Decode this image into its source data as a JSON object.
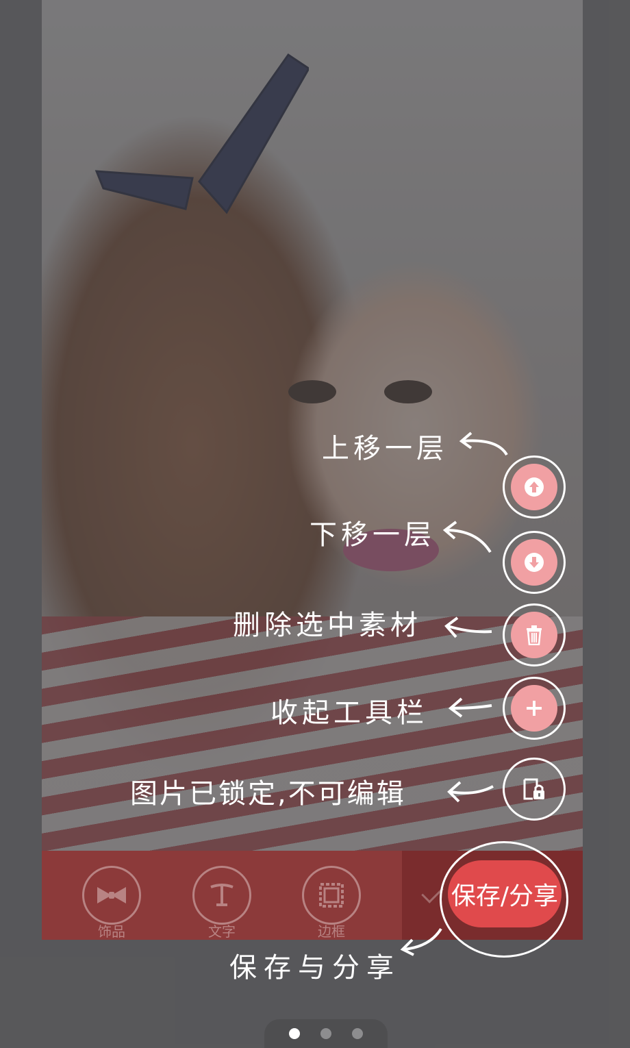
{
  "toolbar": {
    "tools": [
      {
        "label": "饰品",
        "icon": "bow-icon"
      },
      {
        "label": "文字",
        "icon": "text-icon"
      },
      {
        "label": "边框",
        "icon": "frame-icon"
      }
    ],
    "save_label": "保存/分享"
  },
  "actions": [
    {
      "hint": "上移一层",
      "icon": "arrow-up-icon"
    },
    {
      "hint": "下移一层",
      "icon": "arrow-down-icon"
    },
    {
      "hint": "删除选中素材",
      "icon": "trash-icon"
    },
    {
      "hint": "收起工具栏",
      "icon": "plus-icon"
    },
    {
      "hint": "图片已锁定,不可编辑",
      "icon": "lock-icon"
    }
  ],
  "save_hint": "保存与分享",
  "pager": {
    "pages": 3,
    "current": 1
  },
  "colors": {
    "accent": "#e04a4c",
    "button_fill": "#f1a0a3",
    "toolbar": "#8c3a3a"
  }
}
